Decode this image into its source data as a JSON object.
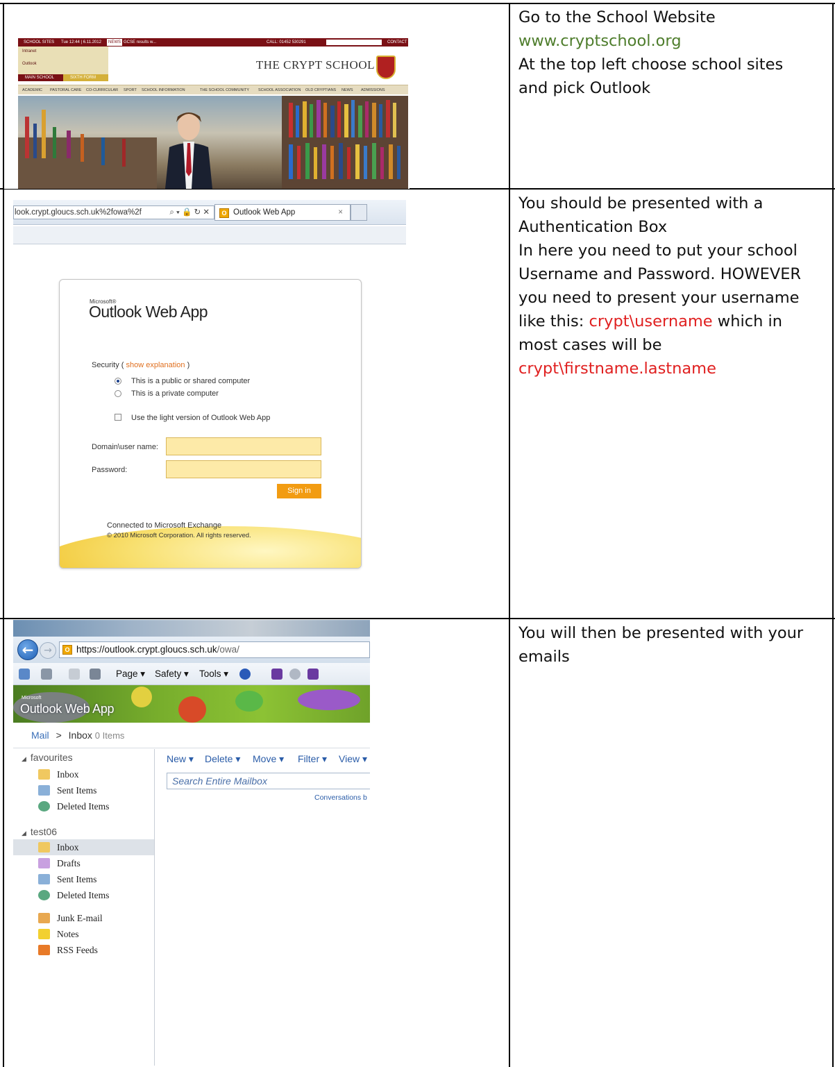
{
  "rows": [
    {
      "instruction_lines": [
        {
          "text": "Go to the School Website",
          "color": "default"
        },
        {
          "text": "www.cryptschool.org",
          "color": "green"
        },
        {
          "text": "At the top left choose school sites",
          "color": "default"
        },
        {
          "text": "and pick Outlook",
          "color": "default"
        }
      ]
    },
    {
      "instruction_lines": [
        {
          "text": "You should be presented with a",
          "color": "default"
        },
        {
          "text": "Authentication Box",
          "color": "default"
        },
        {
          "text": "In here you need to put your school",
          "color": "default"
        },
        {
          "text": "Username and Password.  HOWEVER",
          "color": "default"
        },
        {
          "text": "you need to present your username",
          "color": "default"
        },
        {
          "text": "like this:  ",
          "color": "default",
          "red_suffix": "crypt\\username",
          "tail": " which in"
        },
        {
          "text": "most cases will be",
          "color": "default"
        },
        {
          "text": "crypt\\firstname.lastname",
          "color": "red"
        }
      ]
    },
    {
      "instruction_lines": [
        {
          "text": "You will then be presented with your",
          "color": "default"
        },
        {
          "text": "emails",
          "color": "default"
        }
      ]
    }
  ],
  "school_site": {
    "school_sites_label": "SCHOOL SITES",
    "datetime": "Tue 12:44 | 6.11.2012",
    "news_label": "NEWS",
    "news_ticker": "GCSE results w...",
    "phone": "CALL: 01452 530291",
    "contact": "CONTACT US",
    "dropdown": [
      "Intranet",
      "Outlook"
    ],
    "main_school": "MAIN SCHOOL",
    "sixth_form": "SIXTH FORM",
    "school_name": "THE CRYPT SCHOOL",
    "nav": [
      "ACADEMIC",
      "PASTORAL CARE",
      "CO-CURRICULAR",
      "SPORT",
      "SCHOOL INFORMATION",
      "THE SCHOOL COMMUNITY",
      "SCHOOL ASSOCIATION",
      "OLD CRYPTIANS",
      "NEWS",
      "ADMISSIONS"
    ]
  },
  "login_browser": {
    "url": "look.crypt.gloucs.sch.uk%2fowa%2f",
    "tab_title": "Outlook Web App"
  },
  "login": {
    "ms_label": "Microsoft®",
    "logo": "Outlook Web App",
    "security_label": "Security ( ",
    "show_explanation": "show explanation",
    "security_close": " )",
    "radio_public": "This is a public or shared computer",
    "radio_private": "This is a private computer",
    "light_version": "Use the light version of Outlook Web App",
    "username_label": "Domain\\user name:",
    "password_label": "Password:",
    "sign_in": "Sign in",
    "connected": "Connected to Microsoft Exchange",
    "copyright": "© 2010 Microsoft Corporation. All rights reserved."
  },
  "inbox_browser": {
    "url_host": "https://outlook.crypt.gloucs.sch.uk",
    "url_path": "/owa/",
    "commands": [
      "Page ▾",
      "Safety ▾",
      "Tools ▾"
    ]
  },
  "owa": {
    "ms_label": "Microsoft",
    "title": "Outlook Web App",
    "breadcrumb_root": "Mail",
    "breadcrumb_sep": ">",
    "breadcrumb_folder": "Inbox",
    "breadcrumb_count": "0 Items",
    "favourites_header": "favourites",
    "favourites": [
      "Inbox",
      "Sent Items",
      "Deleted Items"
    ],
    "account_header": "test06",
    "folders": [
      "Inbox",
      "Drafts",
      "Sent Items",
      "Deleted Items",
      "Junk E-mail",
      "Notes",
      "RSS Feeds"
    ],
    "toolbar": [
      "New ▾",
      "Delete ▾",
      "Move ▾",
      "Filter ▾",
      "View ▾"
    ],
    "search_placeholder": "Search Entire Mailbox",
    "conversations": "Conversations b"
  },
  "colors": {
    "link_green": "#4e7d2c",
    "highlight_red": "#e02020",
    "school_maroon": "#7a1015",
    "owa_orange": "#f29c12"
  }
}
